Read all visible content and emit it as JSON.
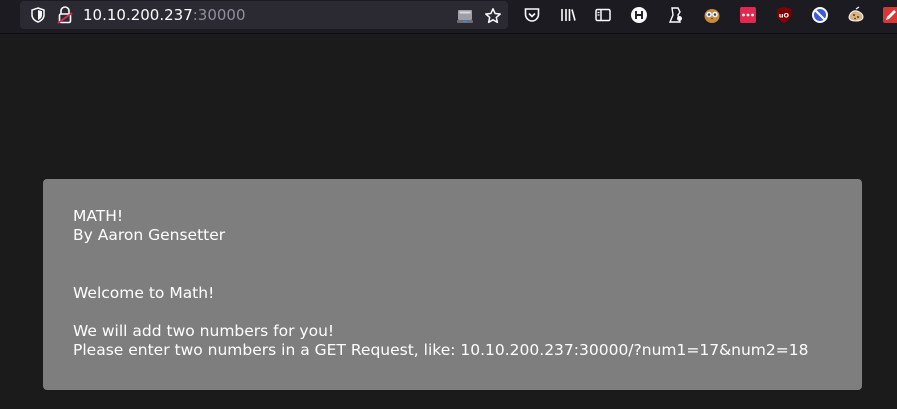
{
  "browser": {
    "url_host": "10.10.200.237",
    "url_port": ":30000",
    "icons": [
      "shield-icon",
      "lock-icon",
      "reader-view-icon",
      "bookmark-star-icon",
      "pocket-icon",
      "library-icon",
      "sidebar-icon",
      "h-extension-icon",
      "profile-icon",
      "owl-extension-icon",
      "dots-extension-icon",
      "ublock-icon",
      "blocker-icon",
      "cookie-icon",
      "pen-extension-icon"
    ]
  },
  "card": {
    "title": "MATH!",
    "author": "By Aaron Gensetter",
    "welcome": "Welcome to Math!",
    "line1": "We will add two numbers for you!",
    "line2": "Please enter two numbers in a GET Request, like: 10.10.200.237:30000/?num1=17&num2=18"
  },
  "colors": {
    "page_bg": "#1c1b1b",
    "card_bg": "#7e7e7e",
    "text": "#ffffff"
  }
}
